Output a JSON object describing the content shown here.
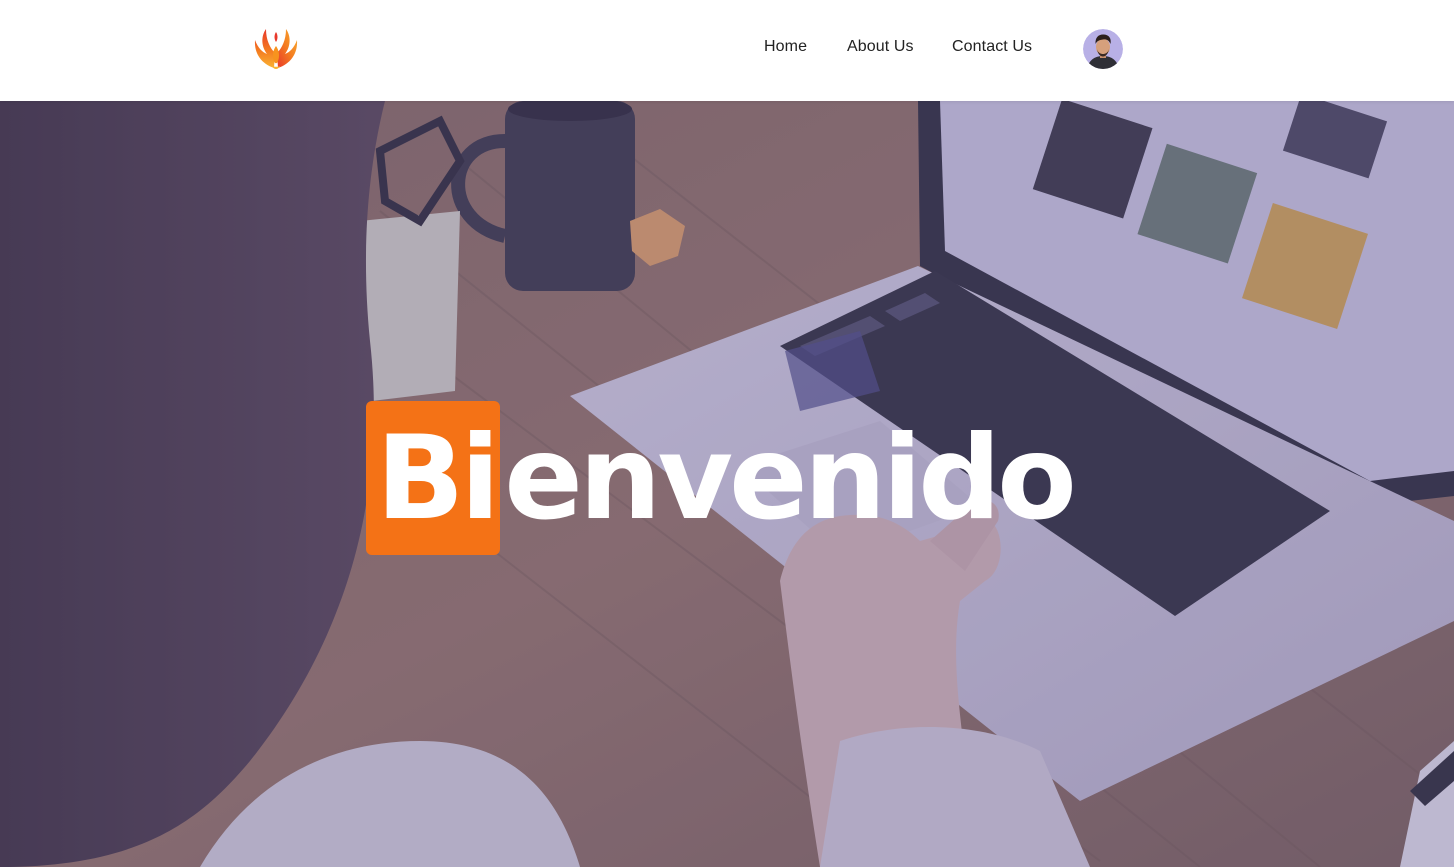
{
  "header": {
    "logo_icon": "phoenix-logo-icon",
    "nav": [
      {
        "label": "Home"
      },
      {
        "label": "About Us"
      },
      {
        "label": "Contact Us"
      }
    ],
    "avatar_icon": "user-avatar"
  },
  "hero": {
    "title_highlight": "Bi",
    "title_rest": "envenido",
    "background_image": "person-using-laptop-on-wooden-desk",
    "colors": {
      "highlight": "#f47216",
      "overlay": "#5854a0",
      "title_text": "#ffffff"
    }
  }
}
